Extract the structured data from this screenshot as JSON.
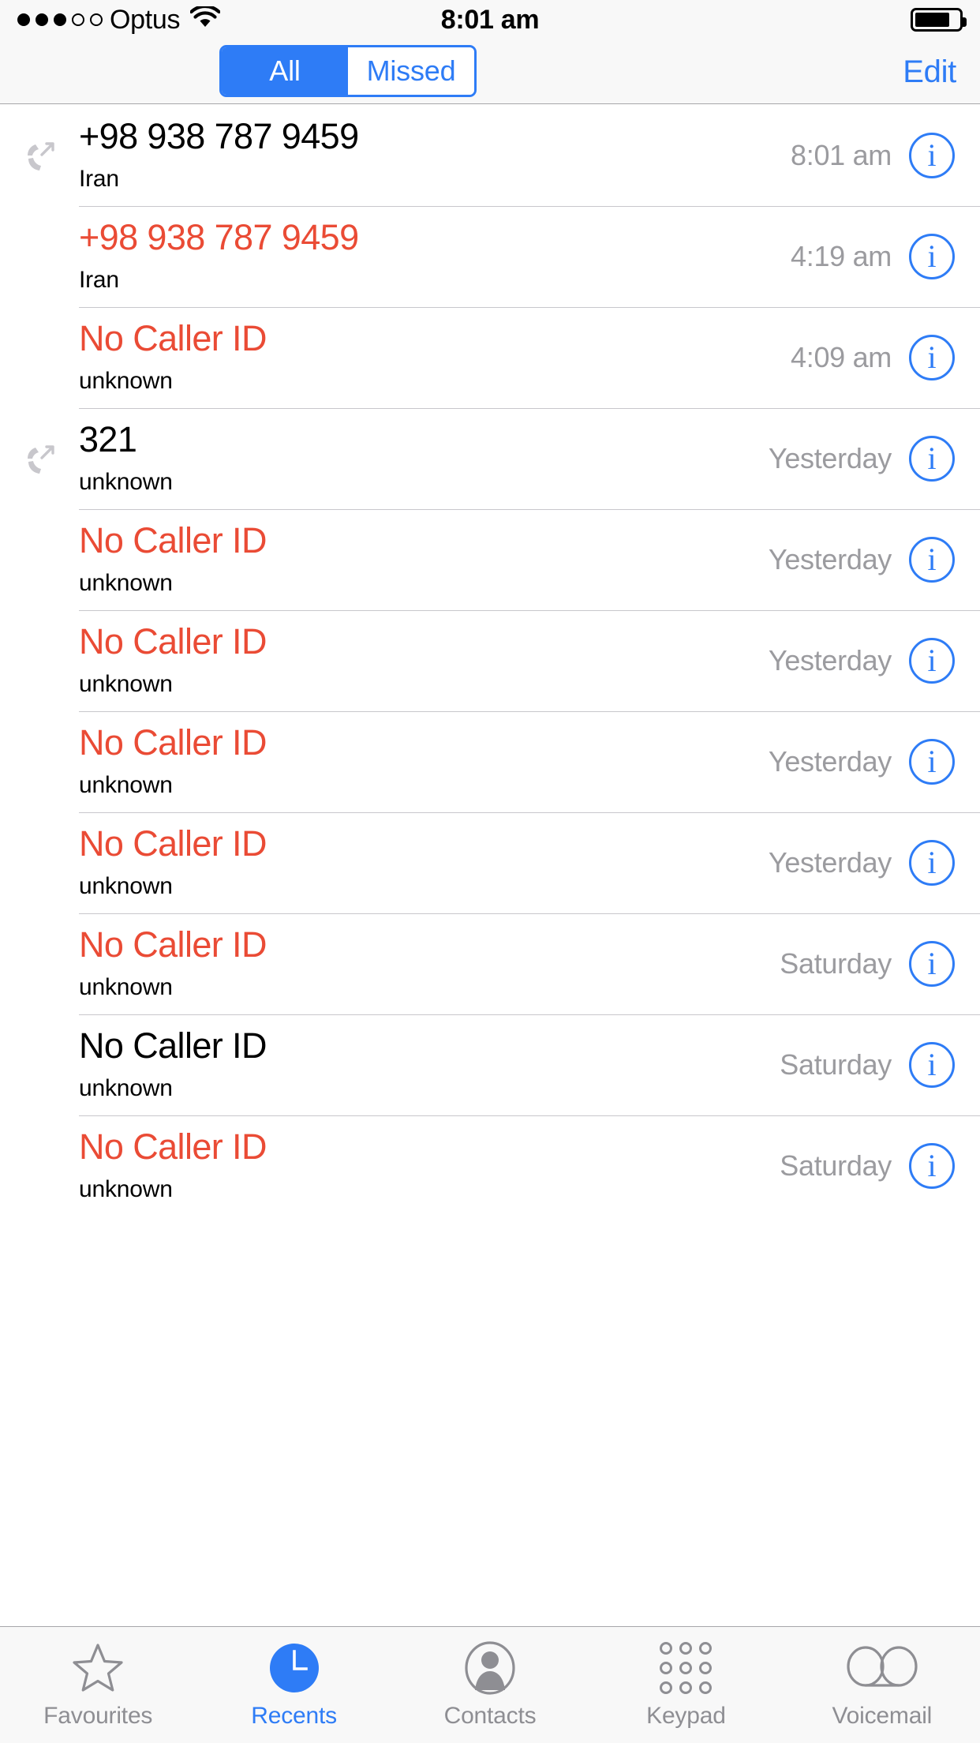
{
  "status_bar": {
    "carrier": "Optus",
    "signal_filled": 3,
    "signal_total": 5,
    "wifi_icon": "wifi-icon",
    "time": "8:01 am",
    "battery_percent": 80
  },
  "nav_bar": {
    "segments": [
      {
        "label": "All",
        "selected": true
      },
      {
        "label": "Missed",
        "selected": false
      }
    ],
    "edit_label": "Edit",
    "accent_color": "#2e7cf6"
  },
  "calls": [
    {
      "title": "+98 938 787 9459",
      "subtitle": "Iran",
      "time": "8:01 am",
      "missed": false,
      "direction": "outgoing"
    },
    {
      "title": "+98 938 787 9459",
      "subtitle": "Iran",
      "time": "4:19 am",
      "missed": true,
      "direction": "none"
    },
    {
      "title": "No Caller ID",
      "subtitle": "unknown",
      "time": "4:09 am",
      "missed": true,
      "direction": "none"
    },
    {
      "title": "321",
      "subtitle": "unknown",
      "time": "Yesterday",
      "missed": false,
      "direction": "outgoing"
    },
    {
      "title": "No Caller ID",
      "subtitle": "unknown",
      "time": "Yesterday",
      "missed": true,
      "direction": "none"
    },
    {
      "title": "No Caller ID",
      "subtitle": "unknown",
      "time": "Yesterday",
      "missed": true,
      "direction": "none"
    },
    {
      "title": "No Caller ID",
      "subtitle": "unknown",
      "time": "Yesterday",
      "missed": true,
      "direction": "none"
    },
    {
      "title": "No Caller ID",
      "subtitle": "unknown",
      "time": "Yesterday",
      "missed": true,
      "direction": "none"
    },
    {
      "title": "No Caller ID",
      "subtitle": "unknown",
      "time": "Saturday",
      "missed": true,
      "direction": "none"
    },
    {
      "title": "No Caller ID",
      "subtitle": "unknown",
      "time": "Saturday",
      "missed": false,
      "direction": "none"
    },
    {
      "title": "No Caller ID",
      "subtitle": "unknown",
      "time": "Saturday",
      "missed": true,
      "direction": "none"
    }
  ],
  "info_button_glyph": "i",
  "colors": {
    "missed_red": "#ea4b35",
    "accent_blue": "#2e7cf6",
    "time_gray": "#9b9b9f",
    "tab_gray": "#8e8e93"
  },
  "tab_bar": {
    "tabs": [
      {
        "label": "Favourites",
        "icon": "star-icon",
        "active": false
      },
      {
        "label": "Recents",
        "icon": "clock-icon",
        "active": true
      },
      {
        "label": "Contacts",
        "icon": "person-icon",
        "active": false
      },
      {
        "label": "Keypad",
        "icon": "keypad-icon",
        "active": false
      },
      {
        "label": "Voicemail",
        "icon": "voicemail-icon",
        "active": false
      }
    ]
  }
}
